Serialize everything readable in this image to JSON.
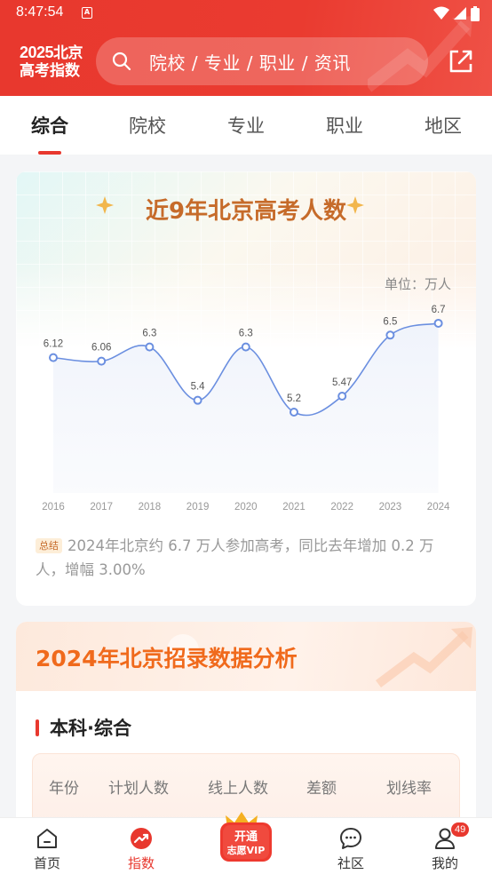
{
  "status_bar": {
    "time": "8:47:54",
    "notification": "A"
  },
  "header": {
    "logo_year": "2025",
    "logo_city": "北京",
    "logo_line2": "高考指数",
    "search_placeholder": "院校 / 专业 / 职业 / 资讯"
  },
  "tabs": [
    {
      "label": "综合",
      "active": true
    },
    {
      "label": "院校",
      "active": false
    },
    {
      "label": "专业",
      "active": false
    },
    {
      "label": "职业",
      "active": false
    },
    {
      "label": "地区",
      "active": false
    }
  ],
  "examinees_card": {
    "title": "近9年北京高考人数",
    "unit_label": "单位：万人",
    "summary_tag": "总结",
    "summary_text": "2024年北京约 6.7 万人参加高考，同比去年增加 0.2 万人，增幅 3.00%"
  },
  "chart_data": {
    "type": "line",
    "title": "近9年北京高考人数",
    "x": [
      "2016",
      "2017",
      "2018",
      "2019",
      "2020",
      "2021",
      "2022",
      "2023",
      "2024"
    ],
    "series": [
      {
        "values": [
          6.12,
          6.06,
          6.3,
          5.4,
          6.3,
          5.2,
          5.47,
          6.5,
          6.7
        ],
        "labels": [
          "6.12",
          "6.06",
          "6.3",
          "5.4",
          "6.3",
          "5.2",
          "5.47",
          "6.5",
          "6.7"
        ]
      }
    ],
    "ylabel": "",
    "xlabel": "",
    "grid": false,
    "line_color": "#6b8fe0"
  },
  "analysis_card": {
    "title": "2024年北京招录数据分析",
    "section_title": "本科·综合",
    "table_headers": [
      "年份",
      "计划人数",
      "线上人数",
      "差额",
      "划线率"
    ]
  },
  "bottom_nav": {
    "items": [
      {
        "label": "首页",
        "icon": "home-icon",
        "active": false
      },
      {
        "label": "指数",
        "icon": "trend-icon",
        "active": true
      },
      {
        "label": "社区",
        "icon": "chat-icon",
        "active": false
      },
      {
        "label": "我的",
        "icon": "user-icon",
        "active": false
      }
    ],
    "vip_line1": "开通",
    "vip_line2": "志愿VIP",
    "badge_count": "49"
  },
  "colors": {
    "brand_red": "#e8382e",
    "title_orange": "#c66b2a",
    "banner_orange": "#f06a1c"
  }
}
